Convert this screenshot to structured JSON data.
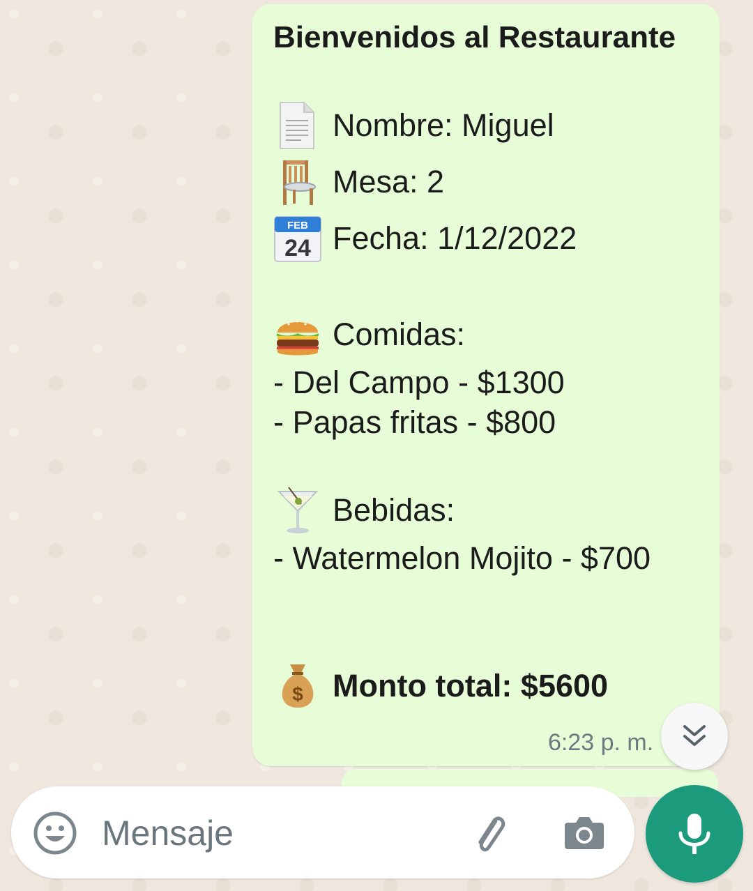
{
  "message": {
    "title": "Bienvenidos al Restaurante",
    "name_line": "Nombre: Miguel",
    "table_line": "Mesa: 2",
    "date_line": "Fecha: 1/12/2022",
    "calendar_month": "FEB",
    "calendar_day": "24",
    "food_header": "Comidas:",
    "food_items": [
      "- Del Campo - $1300",
      "- Papas fritas - $800"
    ],
    "drinks_header": "Bebidas:",
    "drink_items": [
      "- Watermelon Mojito - $700"
    ],
    "total_line": "Monto total: $5600",
    "timestamp": "6:23 p. m."
  },
  "icons": {
    "name": "page-icon",
    "table": "chair-icon",
    "date": "calendar-icon",
    "food": "hamburger-icon",
    "drinks": "cocktail-icon",
    "total": "money-bag-icon"
  },
  "composer": {
    "placeholder": "Mensaje"
  },
  "colors": {
    "bubble": "#e7fdd7",
    "accent": "#1c9b7c",
    "background": "#efe7de"
  }
}
